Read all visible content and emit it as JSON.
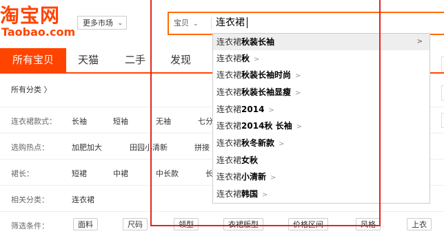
{
  "logo": {
    "main": "淘宝网",
    "sub": "Taobao.com"
  },
  "market_select": {
    "label": "更多市场",
    "icon": "chevron-down-icon"
  },
  "search": {
    "scope": "宝贝",
    "query": "连衣裙",
    "accent": "#ff6a00"
  },
  "tabs": [
    {
      "label": "所有宝贝",
      "active": true
    },
    {
      "label": "天猫"
    },
    {
      "label": "二手"
    },
    {
      "label": "发现"
    }
  ],
  "breadcrumb": {
    "label": "所有分类 〉"
  },
  "filters": {
    "style": {
      "label": "连衣裙款式：",
      "options": [
        "长袖",
        "短袖",
        "无袖",
        "七分"
      ]
    },
    "hot": {
      "label": "选购热点：",
      "options": [
        "加肥加大",
        "田园小清新",
        "拼接"
      ]
    },
    "length": {
      "label": "裙长：",
      "options": [
        "短裙",
        "中裙",
        "中长款",
        "长"
      ]
    },
    "related": {
      "label": "相关分类：",
      "options": [
        "连衣裙"
      ]
    },
    "conditions": {
      "label": "筛选条件：",
      "buttons": [
        "面料",
        "尺码",
        "领型",
        "衣裙版型",
        "价格区间",
        "风格",
        "上衣"
      ]
    }
  },
  "suggestions": [
    {
      "prefix": "连衣裙",
      "suffix": "秋装长袖",
      "has_arrow": true,
      "highlighted": true
    },
    {
      "prefix": "连衣裙",
      "suffix": "秋",
      "has_arrow": true
    },
    {
      "prefix": "连衣裙",
      "suffix": "秋装长袖时尚",
      "has_arrow": true
    },
    {
      "prefix": "连衣裙",
      "suffix": "秋装长袖显瘦",
      "has_arrow": true
    },
    {
      "prefix": "连衣裙",
      "suffix": "2014",
      "has_arrow": true
    },
    {
      "prefix": "连衣裙",
      "suffix": "2014秋 长袖",
      "has_arrow": true
    },
    {
      "prefix": "连衣裙",
      "suffix": "秋冬新款",
      "has_arrow": true
    },
    {
      "prefix": "连衣裙",
      "suffix": "女秋",
      "has_arrow": false
    },
    {
      "prefix": "连衣裙",
      "suffix": "小清新",
      "has_arrow": true
    },
    {
      "prefix": "连衣裙",
      "suffix": "韩国",
      "has_arrow": true
    }
  ],
  "colors": {
    "brand": "#ff4400",
    "highlight_frame": "#e1231f"
  }
}
